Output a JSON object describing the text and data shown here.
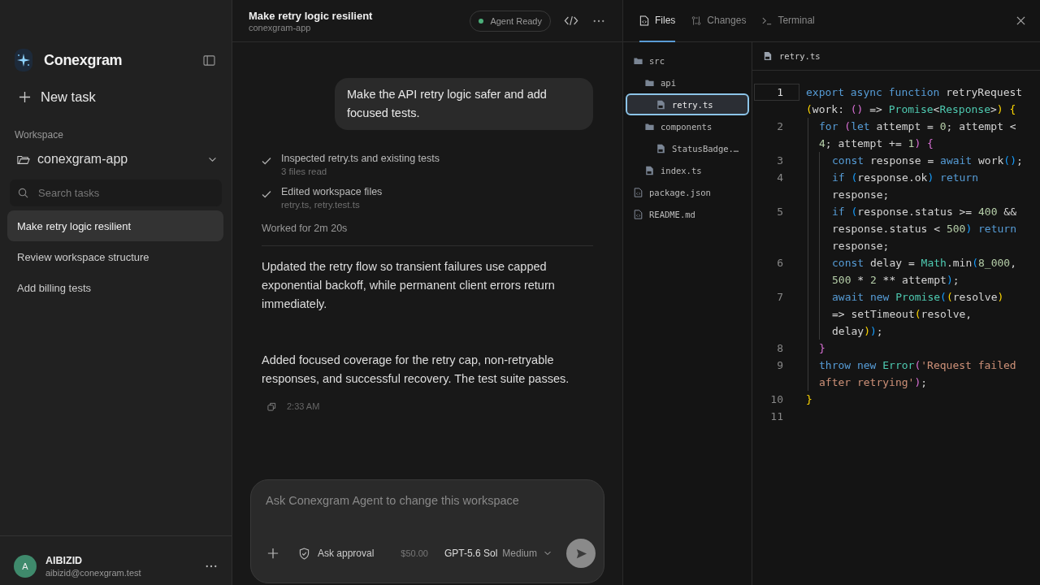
{
  "sidebar": {
    "brand": "Conexgram",
    "new_task": "New task",
    "workspace_label": "Workspace",
    "workspace": "conexgram-app",
    "search": {
      "placeholder": "Search tasks"
    },
    "tasks": [
      {
        "label": "Make retry logic resilient",
        "selected": true
      },
      {
        "label": "Review workspace structure",
        "selected": false
      },
      {
        "label": "Add billing tests",
        "selected": false
      }
    ],
    "user": {
      "initial": "A",
      "name": "AIBIZID",
      "email": "aibizid@conexgram.test",
      "color": "#3f8a6c"
    }
  },
  "chat": {
    "title": "Make retry logic resilient",
    "subtitle": "conexgram-app",
    "status": {
      "label": "Agent Ready",
      "color": "#4caf7a"
    },
    "user_message": "Make the API retry logic safer and add focused tests.",
    "steps": [
      {
        "title": "Inspected retry.ts and existing tests",
        "detail": "3 files read"
      },
      {
        "title": "Edited workspace files",
        "detail": "retry.ts, retry.test.ts"
      }
    ],
    "worked": "Worked for 2m 20s",
    "paragraphs": [
      "Updated the retry flow so transient failures use capped exponential backoff, while permanent client errors return immediately.",
      "Added focused coverage for the retry cap, non-retryable responses, and successful recovery. The test suite passes."
    ],
    "time": "2:33 AM",
    "composer": {
      "placeholder": "Ask Conexgram Agent to change this workspace",
      "approval": "Ask approval",
      "cost": "$50.00",
      "model": "GPT-5.6 Sol",
      "effort": "Medium",
      "send_disabled": true
    }
  },
  "panel": {
    "tabs": [
      {
        "label": "Files",
        "kind": "files",
        "selected": true
      },
      {
        "label": "Changes",
        "kind": "changes",
        "selected": false
      },
      {
        "label": "Terminal",
        "kind": "terminal",
        "selected": false
      }
    ],
    "tree": [
      {
        "name": "src",
        "kind": "folder",
        "selected": false,
        "children": [
          {
            "name": "api",
            "kind": "folder",
            "selected": false,
            "children": [
              {
                "name": "retry.ts",
                "kind": "ts",
                "selected": true
              }
            ]
          },
          {
            "name": "components",
            "kind": "folder",
            "selected": false,
            "children": [
              {
                "name": "StatusBadge.…",
                "kind": "ts",
                "selected": false
              }
            ]
          },
          {
            "name": "index.ts",
            "kind": "ts",
            "selected": false
          }
        ]
      },
      {
        "name": "package.json",
        "kind": "file",
        "selected": false
      },
      {
        "name": "README.md",
        "kind": "file",
        "selected": false
      }
    ],
    "code": {
      "file": "retry.ts",
      "lines": [
        {
          "number": "1",
          "current": true,
          "wraps": [
            {
              "parts": [
                {
                  "text": "export ",
                  "kind": "keyword"
                },
                {
                  "text": "async ",
                  "kind": "keyword"
                },
                {
                  "text": "function",
                  "kind": "keyword"
                },
                {
                  "text": " retryRequest",
                  "kind": "plain"
                }
              ]
            },
            {
              "parts": [
                {
                  "text": "(",
                  "kind": "bracket1"
                },
                {
                  "text": "work: ",
                  "kind": "plain"
                },
                {
                  "text": "()",
                  "kind": "bracket2"
                },
                {
                  "text": " => ",
                  "kind": "plain"
                },
                {
                  "text": "Promise",
                  "kind": "type"
                },
                {
                  "text": "<",
                  "kind": "plain"
                },
                {
                  "text": "Response",
                  "kind": "type"
                },
                {
                  "text": ">",
                  "kind": "plain"
                },
                {
                  "text": ") ",
                  "kind": "bracket1"
                },
                {
                  "text": "{",
                  "kind": "bracket1"
                }
              ]
            }
          ],
          "children": [
            {
              "number": "2",
              "current": false,
              "wraps": [
                {
                  "parts": [
                    {
                      "text": "for ",
                      "kind": "keyword"
                    },
                    {
                      "text": "(",
                      "kind": "bracket2"
                    },
                    {
                      "text": "let",
                      "kind": "keyword"
                    },
                    {
                      "text": " attempt = ",
                      "kind": "plain"
                    },
                    {
                      "text": "0",
                      "kind": "number"
                    },
                    {
                      "text": "; attempt <",
                      "kind": "plain"
                    }
                  ]
                },
                {
                  "parts": [
                    {
                      "text": "4",
                      "kind": "number"
                    },
                    {
                      "text": "; attempt += ",
                      "kind": "plain"
                    },
                    {
                      "text": "1",
                      "kind": "number"
                    },
                    {
                      "text": ") ",
                      "kind": "bracket2"
                    },
                    {
                      "text": "{",
                      "kind": "bracket2"
                    }
                  ]
                }
              ],
              "children": [
                {
                  "number": "3",
                  "current": false,
                  "wraps": [
                    {
                      "parts": [
                        {
                          "text": "const",
                          "kind": "keyword"
                        },
                        {
                          "text": " response = ",
                          "kind": "plain"
                        },
                        {
                          "text": "await",
                          "kind": "keyword"
                        },
                        {
                          "text": " work",
                          "kind": "plain"
                        },
                        {
                          "text": "()",
                          "kind": "bracket3"
                        },
                        {
                          "text": ";",
                          "kind": "plain"
                        }
                      ]
                    }
                  ]
                },
                {
                  "number": "4",
                  "current": false,
                  "wraps": [
                    {
                      "parts": [
                        {
                          "text": "if ",
                          "kind": "keyword"
                        },
                        {
                          "text": "(",
                          "kind": "bracket3"
                        },
                        {
                          "text": "response.ok",
                          "kind": "plain"
                        },
                        {
                          "text": ") ",
                          "kind": "bracket3"
                        },
                        {
                          "text": "return",
                          "kind": "keyword"
                        }
                      ]
                    },
                    {
                      "parts": [
                        {
                          "text": "response;",
                          "kind": "plain"
                        }
                      ]
                    }
                  ]
                },
                {
                  "number": "5",
                  "current": false,
                  "wraps": [
                    {
                      "parts": [
                        {
                          "text": "if ",
                          "kind": "keyword"
                        },
                        {
                          "text": "(",
                          "kind": "bracket3"
                        },
                        {
                          "text": "response.status >= ",
                          "kind": "plain"
                        },
                        {
                          "text": "400",
                          "kind": "number"
                        },
                        {
                          "text": " &&",
                          "kind": "plain"
                        }
                      ]
                    },
                    {
                      "parts": [
                        {
                          "text": "response.status < ",
                          "kind": "plain"
                        },
                        {
                          "text": "500",
                          "kind": "number"
                        },
                        {
                          "text": ") ",
                          "kind": "bracket3"
                        },
                        {
                          "text": "return",
                          "kind": "keyword"
                        }
                      ]
                    },
                    {
                      "parts": [
                        {
                          "text": "response;",
                          "kind": "plain"
                        }
                      ]
                    }
                  ]
                },
                {
                  "number": "6",
                  "current": false,
                  "wraps": [
                    {
                      "parts": [
                        {
                          "text": "const",
                          "kind": "keyword"
                        },
                        {
                          "text": " delay = ",
                          "kind": "plain"
                        },
                        {
                          "text": "Math",
                          "kind": "type"
                        },
                        {
                          "text": ".min",
                          "kind": "plain"
                        },
                        {
                          "text": "(",
                          "kind": "bracket3"
                        },
                        {
                          "text": "8_000",
                          "kind": "number"
                        },
                        {
                          "text": ",",
                          "kind": "plain"
                        }
                      ]
                    },
                    {
                      "parts": [
                        {
                          "text": "500",
                          "kind": "number"
                        },
                        {
                          "text": " * ",
                          "kind": "plain"
                        },
                        {
                          "text": "2",
                          "kind": "number"
                        },
                        {
                          "text": " ** attempt",
                          "kind": "plain"
                        },
                        {
                          "text": ")",
                          "kind": "bracket3"
                        },
                        {
                          "text": ";",
                          "kind": "plain"
                        }
                      ]
                    }
                  ]
                },
                {
                  "number": "7",
                  "current": false,
                  "wraps": [
                    {
                      "parts": [
                        {
                          "text": "await ",
                          "kind": "keyword"
                        },
                        {
                          "text": "new ",
                          "kind": "keyword"
                        },
                        {
                          "text": "Promise",
                          "kind": "type"
                        },
                        {
                          "text": "(",
                          "kind": "bracket3"
                        },
                        {
                          "text": "(",
                          "kind": "bracket1"
                        },
                        {
                          "text": "resolve",
                          "kind": "plain"
                        },
                        {
                          "text": ")",
                          "kind": "bracket1"
                        }
                      ]
                    },
                    {
                      "parts": [
                        {
                          "text": "=> setTimeout",
                          "kind": "plain"
                        },
                        {
                          "text": "(",
                          "kind": "bracket1"
                        },
                        {
                          "text": "resolve,",
                          "kind": "plain"
                        }
                      ]
                    },
                    {
                      "parts": [
                        {
                          "text": "delay",
                          "kind": "plain"
                        },
                        {
                          "text": ")",
                          "kind": "bracket1"
                        },
                        {
                          "text": ")",
                          "kind": "bracket3"
                        },
                        {
                          "text": ";",
                          "kind": "plain"
                        }
                      ]
                    }
                  ]
                }
              ]
            },
            {
              "number": "8",
              "current": false,
              "wraps": [
                {
                  "parts": [
                    {
                      "text": "}",
                      "kind": "bracket2"
                    }
                  ]
                }
              ]
            },
            {
              "number": "9",
              "current": false,
              "wraps": [
                {
                  "parts": [
                    {
                      "text": "throw ",
                      "kind": "keyword"
                    },
                    {
                      "text": "new ",
                      "kind": "keyword"
                    },
                    {
                      "text": "Error",
                      "kind": "type"
                    },
                    {
                      "text": "(",
                      "kind": "bracket2"
                    },
                    {
                      "text": "'Request failed",
                      "kind": "string"
                    }
                  ]
                },
                {
                  "parts": [
                    {
                      "text": "after retrying'",
                      "kind": "string"
                    },
                    {
                      "text": ")",
                      "kind": "bracket2"
                    },
                    {
                      "text": ";",
                      "kind": "plain"
                    }
                  ]
                }
              ]
            }
          ]
        },
        {
          "number": "10",
          "current": false,
          "wraps": [
            {
              "parts": [
                {
                  "text": "}",
                  "kind": "bracket1"
                }
              ]
            }
          ]
        },
        {
          "number": "11",
          "current": false
        }
      ]
    }
  }
}
